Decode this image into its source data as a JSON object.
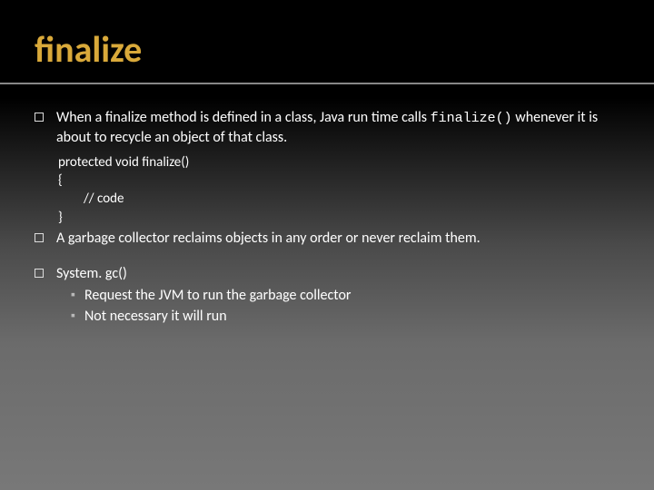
{
  "title": "finalize",
  "bullets": {
    "b1_pre": "When a finalize method is defined in a class, Java run time calls ",
    "b1_code": "finalize()",
    "b1_post": " whenever it is about to recycle an object of that class.",
    "b2": "A garbage collector reclaims objects in any order or never reclaim them.",
    "b3": "System. gc()",
    "b3_sub1": "Request the JVM to run the garbage collector",
    "b3_sub2": "Not necessary it will run"
  },
  "code": {
    "l1": "protected void finalize()",
    "l2": "{",
    "l3": "// code",
    "l4": "}"
  }
}
